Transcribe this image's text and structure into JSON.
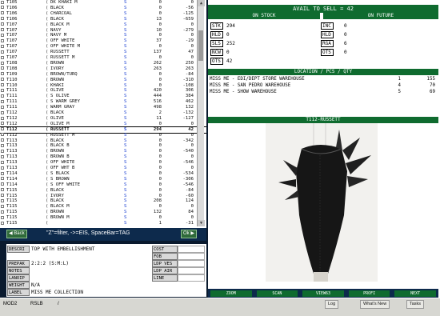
{
  "list_rows": [
    {
      "style": "T105",
      "mark": "(",
      "color": "DK KHAKI M",
      "size": "S",
      "q1": "0",
      "q2": "0"
    },
    {
      "style": "T106",
      "mark": "(",
      "color": "BLACK",
      "size": "S",
      "q1": "0",
      "q2": "-56"
    },
    {
      "style": "T106",
      "mark": "(",
      "color": "CHARCOAL",
      "size": "S",
      "q1": "0",
      "q2": "-125"
    },
    {
      "style": "T106",
      "mark": "(",
      "color": "BLACK",
      "size": "S",
      "q1": "13",
      "q2": "-659"
    },
    {
      "style": "T107",
      "mark": "(",
      "color": "BLACK M",
      "size": "S",
      "q1": "0",
      "q2": "0"
    },
    {
      "style": "T107",
      "mark": "(",
      "color": "NAVY",
      "size": "S",
      "q1": "10",
      "q2": "-279"
    },
    {
      "style": "T107",
      "mark": "(",
      "color": "NAVY M",
      "size": "S",
      "q1": "0",
      "q2": "0"
    },
    {
      "style": "T107",
      "mark": "(",
      "color": "OFF WHITE",
      "size": "S",
      "q1": "37",
      "q2": "-29"
    },
    {
      "style": "T107",
      "mark": "(",
      "color": "OFF WHITE M",
      "size": "S",
      "q1": "0",
      "q2": "0"
    },
    {
      "style": "T107",
      "mark": "(",
      "color": "RUSSETT",
      "size": "S",
      "q1": "137",
      "q2": "47"
    },
    {
      "style": "T107",
      "mark": "(",
      "color": "RUSSETT M",
      "size": "S",
      "q1": "0",
      "q2": "0"
    },
    {
      "style": "T108",
      "mark": "(",
      "color": "BROWN",
      "size": "S",
      "q1": "262",
      "q2": "250"
    },
    {
      "style": "T108",
      "mark": "(",
      "color": "IVORY",
      "size": "S",
      "q1": "263",
      "q2": "263"
    },
    {
      "style": "T109",
      "mark": "(",
      "color": "BROWN/TURQ",
      "size": "S",
      "q1": "0",
      "q2": "-84"
    },
    {
      "style": "T110",
      "mark": "(",
      "color": "BROWN",
      "size": "S",
      "q1": "0",
      "q2": "-310"
    },
    {
      "style": "T110",
      "mark": "(",
      "color": "KHAKI",
      "size": "S",
      "q1": "0",
      "q2": "-108"
    },
    {
      "style": "T111",
      "mark": "(",
      "color": "OLIVE",
      "size": "S",
      "q1": "420",
      "q2": "306"
    },
    {
      "style": "T111",
      "mark": "(",
      "color": "S OLIVE",
      "size": "S",
      "q1": "444",
      "q2": "384"
    },
    {
      "style": "T111",
      "mark": "(",
      "color": "S WARM GREY",
      "size": "S",
      "q1": "516",
      "q2": "462"
    },
    {
      "style": "T111",
      "mark": "(",
      "color": "WARM GRAY",
      "size": "S",
      "q1": "498",
      "q2": "132"
    },
    {
      "style": "T112",
      "mark": "(",
      "color": "BLACK",
      "size": "S",
      "q1": "2",
      "q2": "-132"
    },
    {
      "style": "T112",
      "mark": "(",
      "color": "OLIVE",
      "size": "S",
      "q1": "11",
      "q2": "-127"
    },
    {
      "style": "T112",
      "mark": "(",
      "color": "OLIVE M",
      "size": "S",
      "q1": "0",
      "q2": "0"
    },
    {
      "style": "T112",
      "mark": "(",
      "color": "RUSSETT",
      "size": "S",
      "q1": "294",
      "q2": "42"
    },
    {
      "style": "T112",
      "mark": "(",
      "color": "RUSSETT M",
      "size": "S",
      "q1": "0",
      "q2": "0"
    },
    {
      "style": "T113",
      "mark": "(",
      "color": "BLACK",
      "size": "S",
      "q1": "0",
      "q2": "-342"
    },
    {
      "style": "T113",
      "mark": "(",
      "color": "BLACK B",
      "size": "S",
      "q1": "0",
      "q2": "0"
    },
    {
      "style": "T113",
      "mark": "(",
      "color": "BROWN",
      "size": "S",
      "q1": "0",
      "q2": "-540"
    },
    {
      "style": "T113",
      "mark": "(",
      "color": "BROWN B",
      "size": "S",
      "q1": "0",
      "q2": "0"
    },
    {
      "style": "T113",
      "mark": "(",
      "color": "OFF WHITE",
      "size": "S",
      "q1": "0",
      "q2": "-546"
    },
    {
      "style": "T113",
      "mark": "(",
      "color": "OFF WHT B",
      "size": "S",
      "q1": "0",
      "q2": "0"
    },
    {
      "style": "T114",
      "mark": "(",
      "color": "S BLACK",
      "size": "S",
      "q1": "0",
      "q2": "-534"
    },
    {
      "style": "T114",
      "mark": "(",
      "color": "S BROWN",
      "size": "S",
      "q1": "0",
      "q2": "-306"
    },
    {
      "style": "T114",
      "mark": "(",
      "color": "S OFF WHITE",
      "size": "S",
      "q1": "0",
      "q2": "-546"
    },
    {
      "style": "T115",
      "mark": "(",
      "color": "BLACK",
      "size": "S",
      "q1": "0",
      "q2": "-84"
    },
    {
      "style": "T115",
      "mark": "(",
      "color": "IVORY",
      "size": "S",
      "q1": "0",
      "q2": "-60"
    },
    {
      "style": "T115",
      "mark": "(",
      "color": "BLACK",
      "size": "S",
      "q1": "208",
      "q2": "124"
    },
    {
      "style": "T115",
      "mark": "(",
      "color": "BLACK M",
      "size": "S",
      "q1": "0",
      "q2": "0"
    },
    {
      "style": "T115",
      "mark": "(",
      "color": "BROWN",
      "size": "S",
      "q1": "132",
      "q2": "84"
    },
    {
      "style": "T115",
      "mark": "(",
      "color": "BROWN M",
      "size": "S",
      "q1": "0",
      "q2": "0"
    },
    {
      "style": "T115",
      "mark": "(",
      "color": "",
      "size": "S",
      "q1": "1",
      "q2": "-31"
    }
  ],
  "selected_row_index": 23,
  "nav": {
    "back_label": "Back",
    "next_label": "Ok",
    "hint": "\"Z\"=filter, ->=EIS, SpaceBar=TAG"
  },
  "form": {
    "descri_label": "DESCRI",
    "descri_value": "TOP WITH EMBELLISHMENT",
    "prepak_label": "PREPAK",
    "prepak_value": "2:2:2 (S:M:L)",
    "notes_label": "NOTES",
    "lanoip_label": "LANOIP",
    "weight_label": "WEIGHT",
    "weight_value": "N/A",
    "label_label": "LABEL",
    "label_value": "MISS ME COLLECTION",
    "right_labels": [
      "COST",
      "FOB",
      "LDP VES",
      "LDP AIR",
      "LINE"
    ]
  },
  "right": {
    "title": "AVAIL TO SELL = 42",
    "on_stock_header": "ON STOCK",
    "on_future_header": "ON FUTURE",
    "stock_left": [
      {
        "label": "STK",
        "value": "294"
      },
      {
        "label": "HLD",
        "value": "0"
      },
      {
        "label": "SLS",
        "value": "252"
      },
      {
        "label": "NCW",
        "value": "0"
      },
      {
        "label": "OTS",
        "value": "42"
      }
    ],
    "stock_right": [
      {
        "label": "INC",
        "value": "0"
      },
      {
        "label": "HLD",
        "value": "0"
      },
      {
        "label": "RGA",
        "value": "6"
      },
      {
        "label": "OTS",
        "value": "0"
      }
    ],
    "location_header": "LOCATION / PCS / QTY",
    "locations": [
      {
        "name": "MISS ME - EDI/DEPT STORE WAREHOUSE",
        "loc": "1",
        "qty": "155"
      },
      {
        "name": "MISS ME - SAN PEDRO WAREHOUSE",
        "loc": "4",
        "qty": "70"
      },
      {
        "name": "MISS ME - SHOW WAREHOUSE",
        "loc": "5",
        "qty": "69"
      }
    ],
    "image_header": "T112-RUSSETT",
    "tabs": [
      "ZOOM",
      "SCAN",
      "VIEW63",
      "PROFI",
      "NEXT"
    ]
  },
  "taskbar": {
    "items": [
      "MOD2",
      "RSLB",
      "/"
    ],
    "buttons": [
      "Log",
      "What's New",
      "Tasks"
    ]
  },
  "colors": {
    "green": "#0f6b2f",
    "navy": "#0d2a4c"
  }
}
